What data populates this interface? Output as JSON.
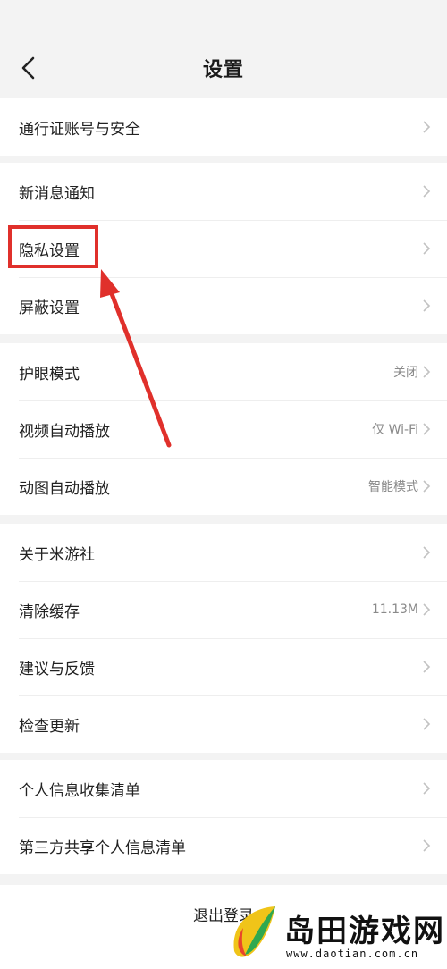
{
  "header": {
    "title": "设置",
    "back_icon": "chevron-left-icon"
  },
  "groups": [
    {
      "items": [
        {
          "label": "通行证账号与安全"
        }
      ]
    },
    {
      "items": [
        {
          "label": "新消息通知"
        },
        {
          "label": "隐私设置"
        },
        {
          "label": "屏蔽设置"
        }
      ]
    },
    {
      "items": [
        {
          "label": "护眼模式",
          "value": "关闭"
        },
        {
          "label": "视频自动播放",
          "value": "仅 Wi-Fi"
        },
        {
          "label": "动图自动播放",
          "value": "智能模式"
        }
      ]
    },
    {
      "items": [
        {
          "label": "关于米游社"
        },
        {
          "label": "清除缓存",
          "value": "11.13M"
        },
        {
          "label": "建议与反馈"
        },
        {
          "label": "检查更新"
        }
      ]
    },
    {
      "items": [
        {
          "label": "个人信息收集清单"
        },
        {
          "label": "第三方共享个人信息清单"
        }
      ]
    }
  ],
  "logout": {
    "label": "退出登录"
  },
  "annotation": {
    "highlight_color": "#e0302b"
  },
  "watermark": {
    "title": "岛田游戏网",
    "url": "www.daotian.com.cn"
  }
}
